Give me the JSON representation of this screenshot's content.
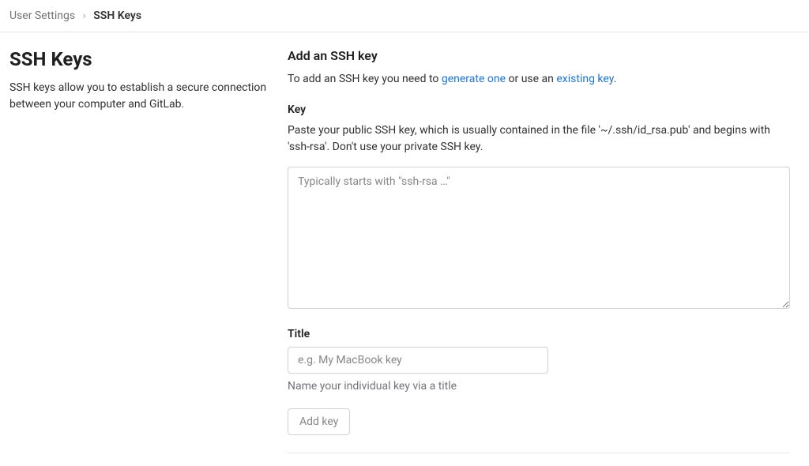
{
  "breadcrumb": {
    "parent": "User Settings",
    "current": "SSH Keys"
  },
  "left": {
    "title": "SSH Keys",
    "description": "SSH keys allow you to establish a secure connection between your computer and GitLab."
  },
  "form": {
    "heading": "Add an SSH key",
    "instruction_prefix": "To add an SSH key you need to ",
    "link_generate": "generate one",
    "instruction_mid": " or use an ",
    "link_existing": "existing key",
    "instruction_suffix": ".",
    "key": {
      "label": "Key",
      "description": "Paste your public SSH key, which is usually contained in the file '~/.ssh/id_rsa.pub' and begins with 'ssh-rsa'. Don't use your private SSH key.",
      "placeholder": "Typically starts with \"ssh-rsa …\"",
      "value": ""
    },
    "title_field": {
      "label": "Title",
      "placeholder": "e.g. My MacBook key",
      "value": "",
      "helper": "Name your individual key via a title"
    },
    "submit_label": "Add key"
  }
}
